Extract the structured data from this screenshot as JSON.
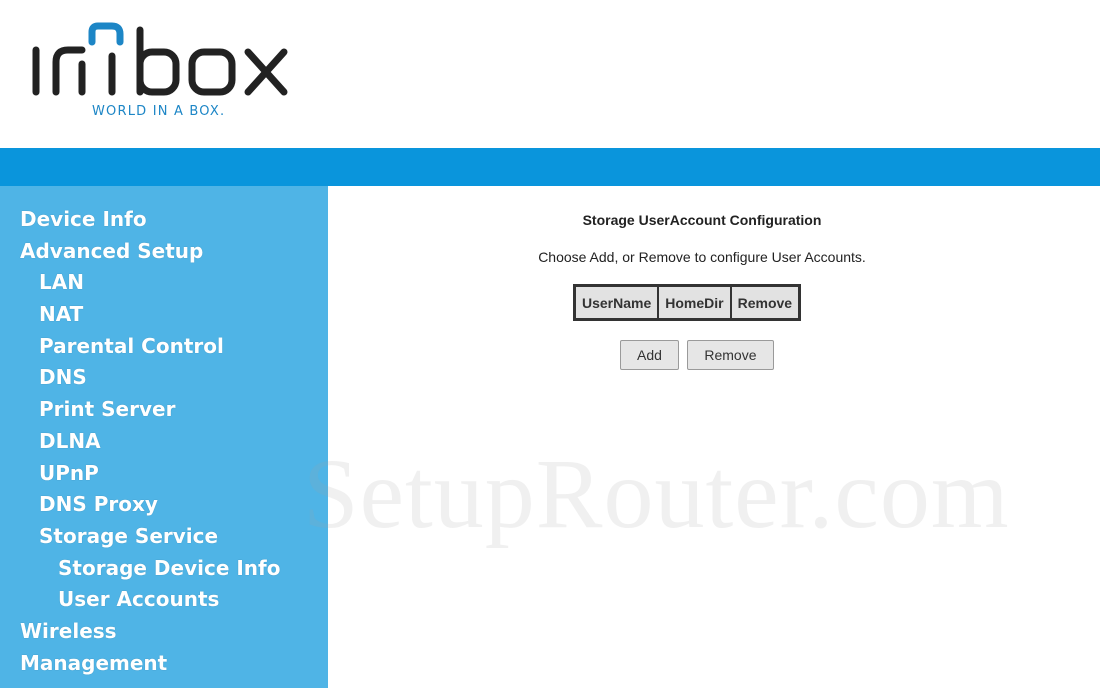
{
  "brand": {
    "logo_text": "imbox",
    "tagline": "WORLD IN A BOX.",
    "colors": {
      "primary": "#0a95dc",
      "sidebar": "#4fb4e6",
      "logo_dark": "#222222",
      "logo_accent": "#1d86c6"
    }
  },
  "sidebar": {
    "items": [
      {
        "label": "Device Info",
        "level": 0
      },
      {
        "label": "Advanced Setup",
        "level": 0
      },
      {
        "label": "LAN",
        "level": 1
      },
      {
        "label": "NAT",
        "level": 1
      },
      {
        "label": "Parental Control",
        "level": 1
      },
      {
        "label": "DNS",
        "level": 1
      },
      {
        "label": "Print Server",
        "level": 1
      },
      {
        "label": "DLNA",
        "level": 1
      },
      {
        "label": "UPnP",
        "level": 1
      },
      {
        "label": "DNS Proxy",
        "level": 1
      },
      {
        "label": "Storage Service",
        "level": 1
      },
      {
        "label": "Storage Device Info",
        "level": 2
      },
      {
        "label": "User Accounts",
        "level": 2
      },
      {
        "label": "Wireless",
        "level": 0
      },
      {
        "label": "Management",
        "level": 0
      }
    ]
  },
  "main": {
    "title": "Storage UserAccount Configuration",
    "description": "Choose Add, or Remove to configure User Accounts.",
    "table": {
      "headers": [
        "UserName",
        "HomeDir",
        "Remove"
      ]
    },
    "buttons": {
      "add": "Add",
      "remove": "Remove"
    }
  },
  "watermark": "SetupRouter.com"
}
